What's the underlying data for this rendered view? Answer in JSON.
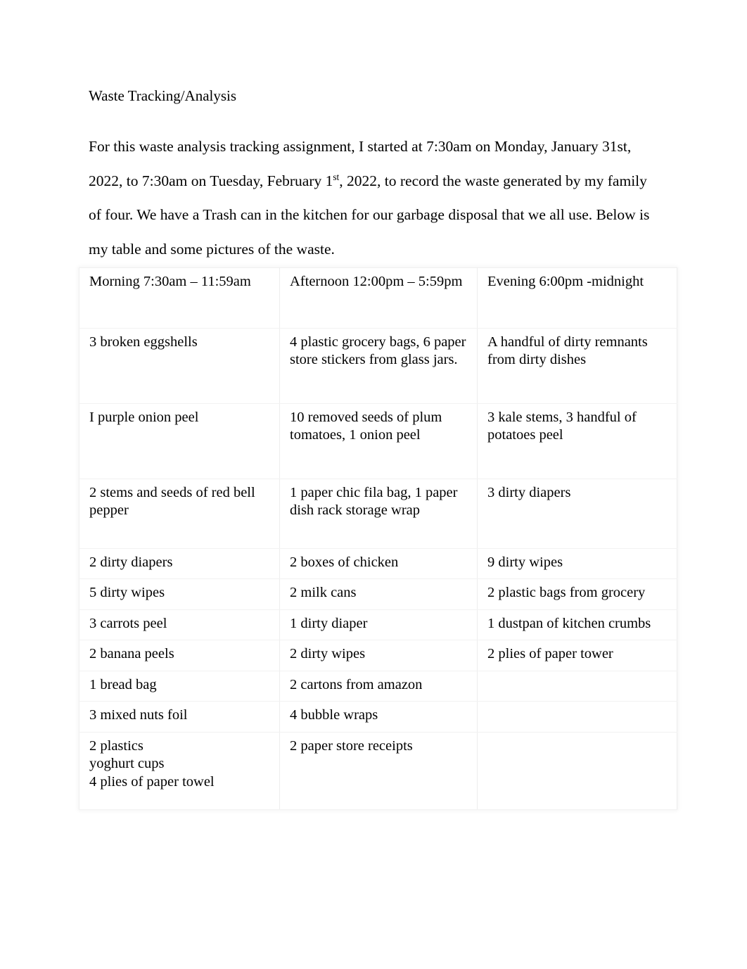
{
  "document": {
    "title": "Waste Tracking/Analysis",
    "paragraph": {
      "line1_pre": "For this waste analysis tracking assignment, I started at 7:30am on Monday, January 31st, 2022, to 7:30am on Tuesday, February 1",
      "superscript": "st",
      "line1_post": ", 2022, to record the waste generated by my family of four. We have a Trash can in the kitchen for our garbage disposal that we all use. Below is my table and some pictures of the waste."
    }
  },
  "table": {
    "headers": [
      "Morning 7:30am – 11:59am",
      "Afternoon 12:00pm – 5:59pm",
      "Evening 6:00pm -midnight"
    ],
    "rows": [
      {
        "morning": [
          "3 broken eggshells"
        ],
        "afternoon": [
          "4 plastic grocery bags, 6 paper store stickers from glass jars."
        ],
        "evening": [
          "A handful of dirty remnants from dirty dishes"
        ]
      },
      {
        "morning": [
          "I purple onion peel"
        ],
        "afternoon": [
          "10 removed seeds of plum tomatoes, 1 onion peel"
        ],
        "evening": [
          "3 kale stems, 3 handful of potatoes peel"
        ]
      },
      {
        "morning": [
          "2 stems and seeds of red bell pepper"
        ],
        "afternoon": [
          "1 paper chic fila bag, 1 paper dish rack storage wrap"
        ],
        "evening": [
          "3 dirty diapers"
        ]
      },
      {
        "morning": [
          "2 dirty diapers"
        ],
        "afternoon": [
          "2 boxes of chicken"
        ],
        "evening": [
          "9 dirty wipes"
        ]
      },
      {
        "morning": [
          "5 dirty wipes"
        ],
        "afternoon": [
          "2 milk cans"
        ],
        "evening": [
          "2 plastic bags from grocery"
        ]
      },
      {
        "morning": [
          "3 carrots peel"
        ],
        "afternoon": [
          "1 dirty diaper"
        ],
        "evening": [
          "1 dustpan of kitchen crumbs"
        ]
      },
      {
        "morning": [
          "2 banana peels"
        ],
        "afternoon": [
          "2 dirty wipes"
        ],
        "evening": [
          "2 plies of paper tower"
        ]
      },
      {
        "morning": [
          "1 bread bag"
        ],
        "afternoon": [
          "2 cartons from amazon"
        ],
        "evening": [
          ""
        ]
      },
      {
        "morning": [
          "3 mixed nuts foil"
        ],
        "afternoon": [
          "4 bubble wraps"
        ],
        "evening": [
          ""
        ]
      },
      {
        "morning": [
          "2 plastics",
          "yoghurt cups",
          "4 plies of paper towel"
        ],
        "afternoon": [
          "2 paper store receipts"
        ],
        "evening": [
          ""
        ]
      }
    ]
  }
}
